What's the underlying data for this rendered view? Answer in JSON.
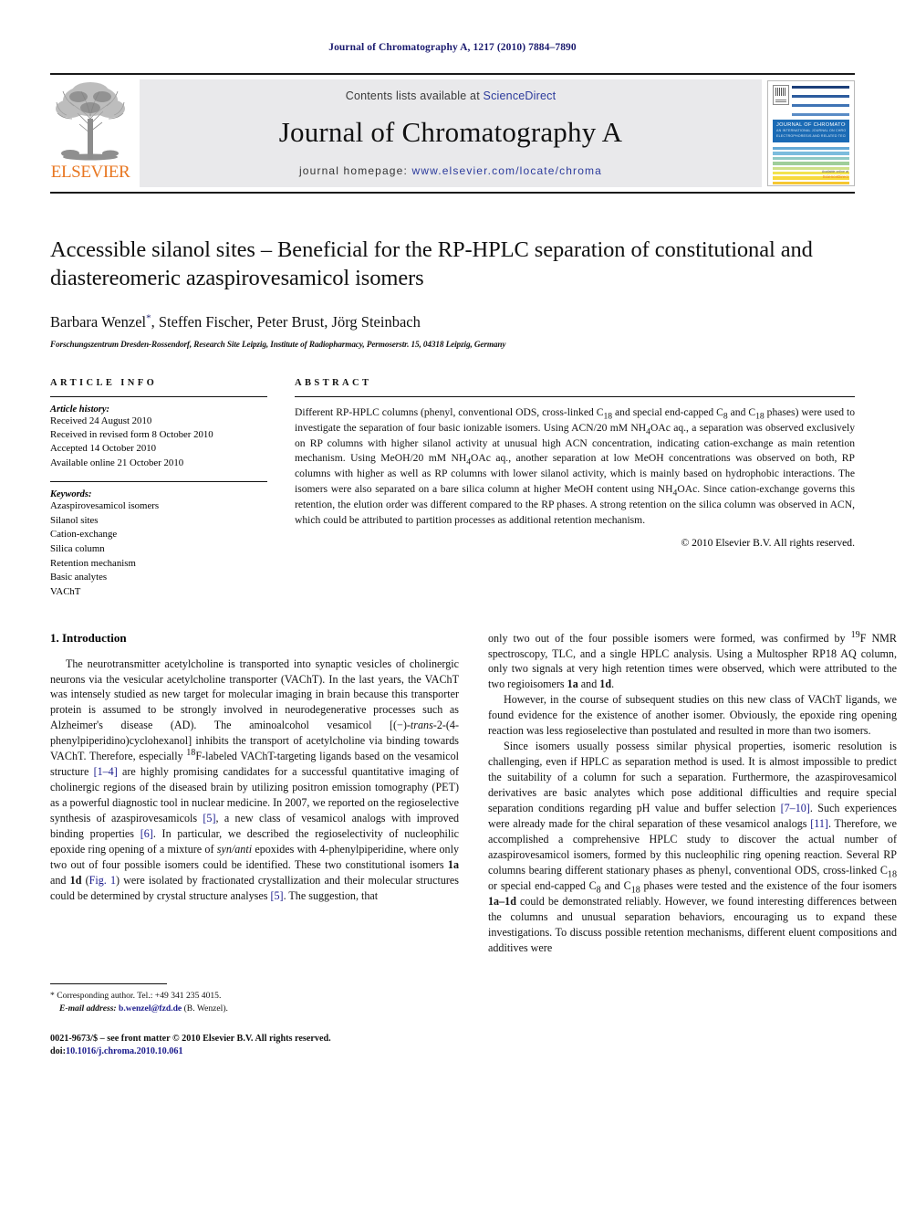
{
  "running_head": "Journal of Chromatography A, 1217 (2010) 7884–7890",
  "masthead": {
    "contents_prefix": "Contents lists available at ",
    "sciencedirect": "ScienceDirect",
    "journal_title": "Journal of Chromatography A",
    "homepage_prefix": "journal homepage: ",
    "homepage_url": "www.elsevier.com/locate/chroma",
    "publisher_wordmark": "ELSEVIER",
    "accent_orange": "#e87722",
    "link_blue": "#2b3a9c",
    "panel_gray": "#e9e9eb"
  },
  "cover": {
    "band_title": "JOURNAL OF CHROMATOGRAPHY A",
    "band_sub1": "AN INTERNATIONAL JOURNAL ON CHROMATOGRAPHY",
    "band_sub2": "ELECTROPHORESIS AND RELATED TECHNIQUES",
    "foot_label": "Available online at",
    "foot_brand": "ScienceDirect",
    "band_color": "#1b6bb5"
  },
  "title": "Accessible silanol sites – Beneficial for the RP-HPLC separation of constitutional and diastereomeric azaspirovesamicol isomers",
  "authors": "Barbara Wenzel*, Steffen Fischer, Peter Brust, Jörg Steinbach",
  "affiliation": "Forschungszentrum Dresden-Rossendorf, Research Site Leipzig, Institute of Radiopharmacy, Permoserstr. 15, 04318 Leipzig, Germany",
  "article_info": {
    "heading": "ARTICLE INFO",
    "history_label": "Article history:",
    "history": [
      "Received 24 August 2010",
      "Received in revised form 8 October 2010",
      "Accepted 14 October 2010",
      "Available online 21 October 2010"
    ],
    "keywords_label": "Keywords:",
    "keywords": [
      "Azaspirovesamicol isomers",
      "Silanol sites",
      "Cation-exchange",
      "Silica column",
      "Retention mechanism",
      "Basic analytes",
      "VAChT"
    ]
  },
  "abstract": {
    "heading": "ABSTRACT",
    "copyright": "© 2010 Elsevier B.V. All rights reserved."
  },
  "introduction": {
    "heading": "1. Introduction"
  },
  "footnotes": {
    "corresponding": "* Corresponding author. Tel.: +49 341 235 4015.",
    "email_label": "E-mail address:",
    "email": "b.wenzel@fzd.de",
    "email_suffix": "(B. Wenzel).",
    "issn_line": "0021-9673/$ – see front matter © 2010 Elsevier B.V. All rights reserved.",
    "doi_label": "doi:",
    "doi": "10.1016/j.chroma.2010.10.061"
  }
}
